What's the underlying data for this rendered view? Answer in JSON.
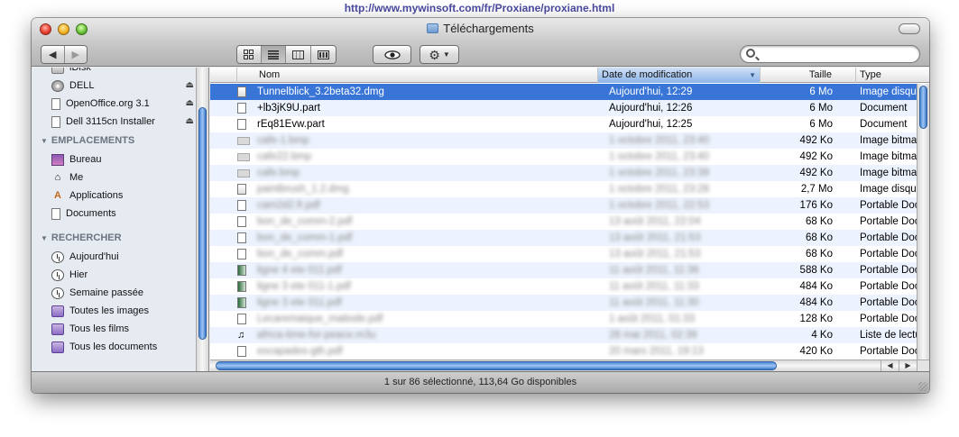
{
  "banner": {
    "url": "http://www.mywinsoft.com/fr/Proxiane/proxiane.html"
  },
  "window": {
    "title": "Téléchargements",
    "status": "1 sur 86 sélectionné, 113,64 Go disponibles"
  },
  "toolbar": {
    "back_icon": "left-arrow-icon",
    "forward_icon": "right-arrow-icon",
    "view_modes": [
      "icon-view-icon",
      "list-view-icon",
      "column-view-icon",
      "coverflow-view-icon"
    ],
    "active_view": 1,
    "quicklook_icon": "eye-icon",
    "action_icon": "gear-icon",
    "search": {
      "value": "",
      "placeholder": ""
    }
  },
  "sidebar": {
    "devices": [
      {
        "label": "iDisk",
        "icon": "disk-icon",
        "eject": false
      },
      {
        "label": "DELL",
        "icon": "cd-icon",
        "eject": true
      },
      {
        "label": "OpenOffice.org 3.1",
        "icon": "document-icon",
        "eject": true
      },
      {
        "label": "Dell 3115cn Installer",
        "icon": "document-icon",
        "eject": true
      }
    ],
    "places_header": "EMPLACEMENTS",
    "places": [
      {
        "label": "Bureau",
        "icon": "desktop-icon"
      },
      {
        "label": "Me",
        "icon": "home-icon"
      },
      {
        "label": "Applications",
        "icon": "applications-icon"
      },
      {
        "label": "Documents",
        "icon": "documents-icon"
      }
    ],
    "search_header": "RECHERCHER",
    "searches": [
      {
        "label": "Aujourd'hui",
        "icon": "clock-icon"
      },
      {
        "label": "Hier",
        "icon": "clock-icon"
      },
      {
        "label": "Semaine passée",
        "icon": "clock-icon"
      },
      {
        "label": "Toutes les images",
        "icon": "smart-folder-icon"
      },
      {
        "label": "Tous les films",
        "icon": "smart-folder-icon"
      },
      {
        "label": "Tous les documents",
        "icon": "smart-folder-icon"
      }
    ]
  },
  "columns": {
    "name": "Nom",
    "date": "Date de modification",
    "size": "Taille",
    "kind": "Type"
  },
  "files": [
    {
      "name": "Tunnelblick_3.2beta32.dmg",
      "date": "Aujourd'hui, 12:29",
      "size": "6 Mo",
      "kind": "Image disque",
      "icon": "dmg",
      "selected": true,
      "blurred": false
    },
    {
      "name": "+lb3jK9U.part",
      "date": "Aujourd'hui, 12:26",
      "size": "6 Mo",
      "kind": "Document",
      "icon": "doc",
      "selected": false,
      "blurred": false
    },
    {
      "name": "rEq81Evw.part",
      "date": "Aujourd'hui, 12:25",
      "size": "6 Mo",
      "kind": "Document",
      "icon": "doc",
      "selected": false,
      "blurred": false
    },
    {
      "name": "cafe-1.bmp",
      "date": "1 octobre 2011, 23:40",
      "size": "492 Ko",
      "kind": "Image bitmap",
      "icon": "wide",
      "selected": false,
      "blurred": true
    },
    {
      "name": "cafe22.bmp",
      "date": "1 octobre 2011, 23:40",
      "size": "492 Ko",
      "kind": "Image bitmap",
      "icon": "wide",
      "selected": false,
      "blurred": true
    },
    {
      "name": "cafe.bmp",
      "date": "1 octobre 2011, 23:39",
      "size": "492 Ko",
      "kind": "Image bitmap",
      "icon": "wide",
      "selected": false,
      "blurred": true
    },
    {
      "name": "paintbrush_1.2.dmg",
      "date": "1 octobre 2011, 23:28",
      "size": "2,7 Mo",
      "kind": "Image disque",
      "icon": "dmg",
      "selected": false,
      "blurred": true
    },
    {
      "name": "cam2d2.fr.pdf",
      "date": "1 octobre 2011, 22:53",
      "size": "176 Ko",
      "kind": "Portable Document",
      "icon": "doc",
      "selected": false,
      "blurred": true
    },
    {
      "name": "bon_de_comm-2.pdf",
      "date": "13 août 2011, 22:04",
      "size": "68 Ko",
      "kind": "Portable Document",
      "icon": "doc",
      "selected": false,
      "blurred": true
    },
    {
      "name": "bon_de_comm-1.pdf",
      "date": "13 août 2011, 21:53",
      "size": "68 Ko",
      "kind": "Portable Document",
      "icon": "doc",
      "selected": false,
      "blurred": true
    },
    {
      "name": "bon_de_comm.pdf",
      "date": "13 août 2011, 21:53",
      "size": "68 Ko",
      "kind": "Portable Document",
      "icon": "doc",
      "selected": false,
      "blurred": true
    },
    {
      "name": "ligne 4 ete 011.pdf",
      "date": "11 août 2011, 11:36",
      "size": "588 Ko",
      "kind": "Portable Document",
      "icon": "color",
      "selected": false,
      "blurred": true
    },
    {
      "name": "ligne 3 ete 011-1.pdf",
      "date": "11 août 2011, 11:33",
      "size": "484 Ko",
      "kind": "Portable Document",
      "icon": "color",
      "selected": false,
      "blurred": true
    },
    {
      "name": "ligne 3 ete 011.pdf",
      "date": "11 août 2011, 11:30",
      "size": "484 Ko",
      "kind": "Portable Document",
      "icon": "color",
      "selected": false,
      "blurred": true
    },
    {
      "name": "Lecaremaique_matiode.pdf",
      "date": "1 août 2011, 01:33",
      "size": "128 Ko",
      "kind": "Portable Document",
      "icon": "doc",
      "selected": false,
      "blurred": true
    },
    {
      "name": "africa-time-for-peace.m3u",
      "date": "28 mai 2011, 02:39",
      "size": "4 Ko",
      "kind": "Liste de lecture",
      "icon": "note",
      "selected": false,
      "blurred": true
    },
    {
      "name": "escapades-gth.pdf",
      "date": "20 mars 2011, 19:13",
      "size": "420 Ko",
      "kind": "Portable Document",
      "icon": "doc",
      "selected": false,
      "blurred": true
    }
  ]
}
